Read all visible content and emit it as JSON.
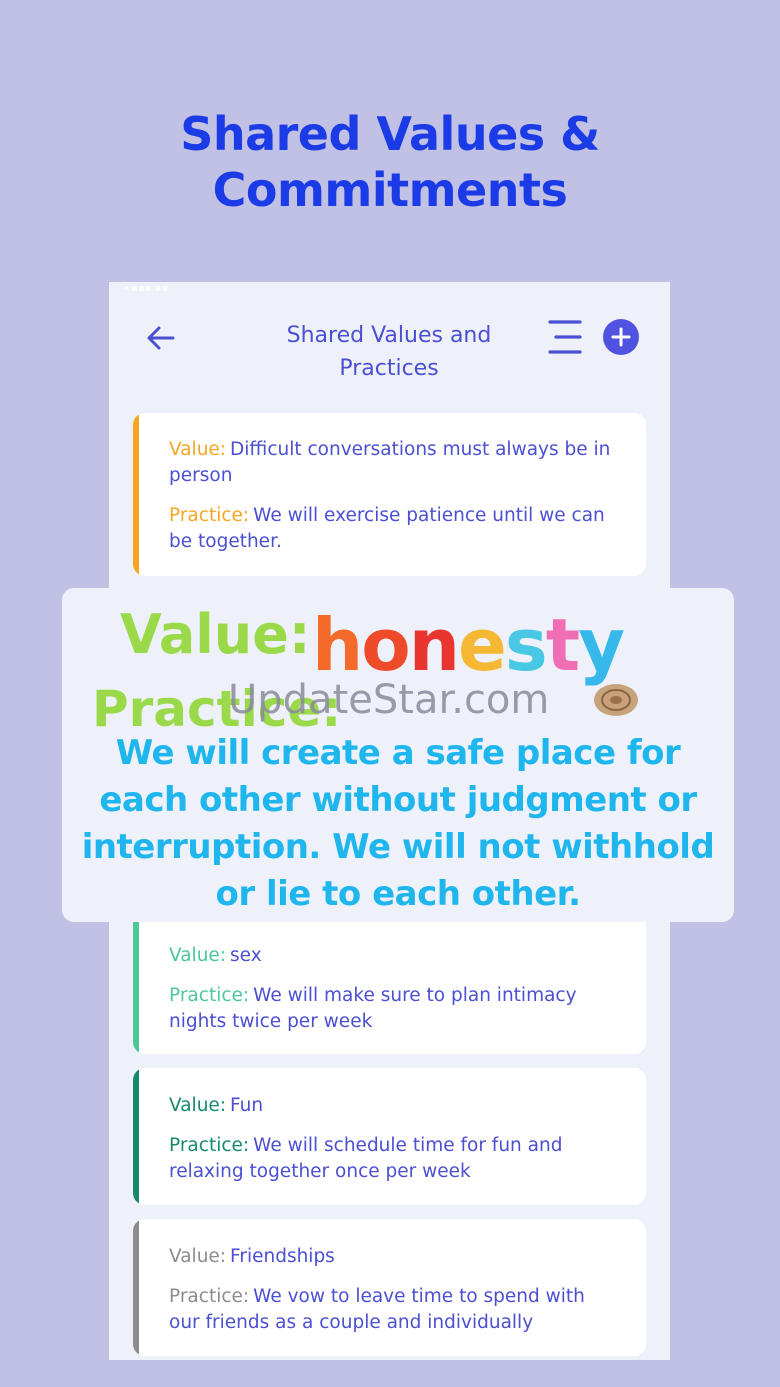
{
  "promo": {
    "title_line1": "Shared Values  &",
    "title_line2": "Commitments"
  },
  "header": {
    "title_line1": "Shared Values and",
    "title_line2": "Practices",
    "back_icon": "arrow-left-icon",
    "menu_icon": "menu-icon",
    "add_icon": "plus-icon"
  },
  "labels": {
    "value": "Value:",
    "practice": "Practice:"
  },
  "cards": [
    {
      "accent": "#f5a623",
      "value": "Difficult conversations must always be in person",
      "practice": "We will exercise patience until we can be together."
    },
    {
      "accent": "#4cc79a",
      "value": "sex",
      "practice": "We will make sure to plan intimacy nights twice per week"
    },
    {
      "accent": "#178a6e",
      "value": "Fun",
      "practice": "We will schedule time for fun and relaxing together once per week"
    },
    {
      "accent": "#8c8c8c",
      "value": "Friendships",
      "practice": "We vow to leave time to spend with our friends as a couple and individually"
    }
  ],
  "overlay": {
    "value_label": "Value:",
    "value_word": "honesty",
    "practice_label": "Practice:",
    "practice_text_line1": "We will create a safe place for",
    "practice_text_line2": "each other without judgment or",
    "practice_text_line3": "interruption. We will not withhold",
    "practice_text_line4": "or lie to each other."
  },
  "watermark": {
    "text": "UpdateStar.com"
  },
  "colors": {
    "background": "#c1c0e5",
    "brand_blue": "#1a3be6",
    "text_purple": "#4b4fd1",
    "overlay_green": "#9ad94a",
    "overlay_cyan": "#1fb6ee"
  }
}
